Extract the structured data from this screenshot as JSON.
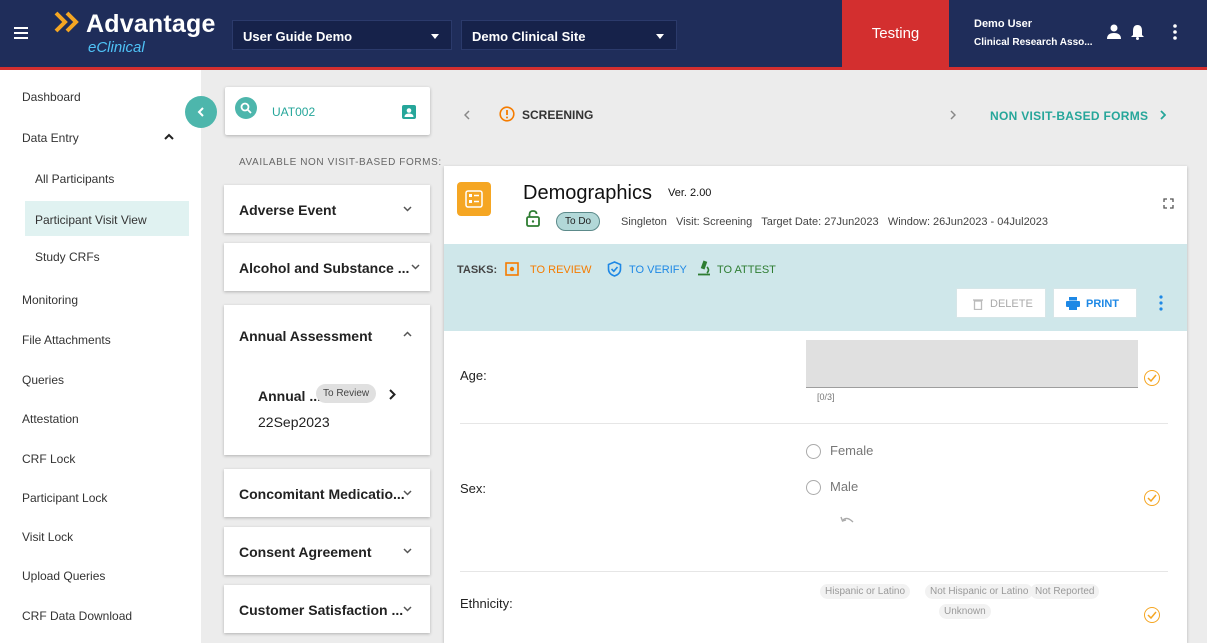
{
  "app": {
    "logo_title": "Advantage",
    "logo_subtitle": "eClinical",
    "study_select": "User Guide Demo",
    "site_select": "Demo Clinical Site",
    "env_badge": "Testing",
    "user_name": "Demo User",
    "user_role": "Clinical Research Asso...",
    "colors": {
      "header_bg": "#1f2d5a",
      "accent": "#4db6ac",
      "env_badge": "#d32f2f",
      "warning": "#f5a623"
    }
  },
  "sidebar": {
    "items": [
      {
        "label": "Dashboard"
      },
      {
        "label": "Data Entry"
      },
      {
        "label": "All Participants"
      },
      {
        "label": "Participant Visit View"
      },
      {
        "label": "Study CRFs"
      },
      {
        "label": "Monitoring"
      },
      {
        "label": "File Attachments"
      },
      {
        "label": "Queries"
      },
      {
        "label": "Attestation"
      },
      {
        "label": "CRF Lock"
      },
      {
        "label": "Participant Lock"
      },
      {
        "label": "Visit Lock"
      },
      {
        "label": "Upload Queries"
      },
      {
        "label": "CRF Data Download"
      }
    ],
    "active": "Participant Visit View"
  },
  "participant_search": {
    "value": "UAT002"
  },
  "forms_list": {
    "heading": "AVAILABLE NON VISIT-BASED FORMS:",
    "cards": [
      {
        "title": "Adverse Event"
      },
      {
        "title": "Alcohol and Substance ..."
      },
      {
        "title": "Annual Assessment",
        "entry": {
          "name": "Annual ...",
          "status": "To Review",
          "date": "22Sep2023"
        }
      },
      {
        "title": "Concomitant Medicatio..."
      },
      {
        "title": "Consent Agreement"
      },
      {
        "title": "Customer Satisfaction ..."
      }
    ]
  },
  "visit_nav": {
    "current": "SCREENING",
    "next": "NON VISIT-BASED FORMS"
  },
  "form": {
    "title": "Demographics",
    "version": "Ver. 2.00",
    "status": "To Do",
    "meta": "Singleton   Visit: Screening   Target Date: 27Jun2023   Window: 26Jun2023 - 04Jul2023",
    "tasks_label": "TASKS:",
    "tasks": [
      "TO REVIEW",
      "TO VERIFY",
      "TO ATTEST"
    ],
    "buttons": {
      "delete": "DELETE",
      "print": "PRINT"
    },
    "fields": {
      "age": {
        "label": "Age:",
        "counter": "[0/3]"
      },
      "sex": {
        "label": "Sex:",
        "options": [
          "Female",
          "Male"
        ]
      },
      "ethnicity": {
        "label": "Ethnicity:",
        "options": [
          "Hispanic or Latino",
          "Not Hispanic or Latino",
          "Not Reported",
          "Unknown"
        ]
      }
    }
  }
}
